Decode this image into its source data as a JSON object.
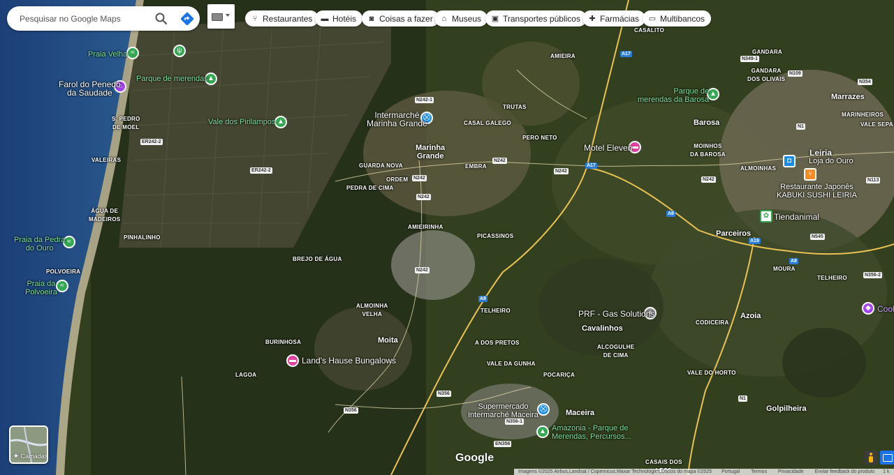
{
  "search": {
    "placeholder": "Pesquisar no Google Maps",
    "search_icon": "search-icon",
    "directions_icon": "directions-icon"
  },
  "keyboard": {
    "icon": "keyboard-icon"
  },
  "chips": [
    {
      "label": "Restaurantes",
      "icon": "fork-knife-icon"
    },
    {
      "label": "Hotéis",
      "icon": "bed-icon"
    },
    {
      "label": "Coisas a fazer",
      "icon": "camera-icon"
    },
    {
      "label": "Museus",
      "icon": "museum-icon"
    },
    {
      "label": "Transportes públicos",
      "icon": "bus-icon"
    },
    {
      "label": "Farmácias",
      "icon": "pharmacy-icon"
    },
    {
      "label": "Multibancos",
      "icon": "atm-icon"
    }
  ],
  "pois": {
    "praia_velha": "Praia Velha",
    "parque_merendas": "Parque de merendas",
    "farol": "Farol do Penedo\nda Saudade",
    "vale_pirilampos": "Vale dos Pirilampos",
    "intermarche_mg": "Intermarché\nMarinha Grande",
    "motel_eleven": "Motel Eleven",
    "parque_barosa": "Parque de\nmerendas da Barosa",
    "restaurante": "Restaurante Japonês\nKABUKI SUSHI LEIRIA",
    "loja_ouro": "Loja do Ouro",
    "tiendanimal": "Tiendanimal",
    "praia_pedra": "Praia da Pedra\ndo Ouro",
    "praia_polvoeira": "Praia da\nPolvoeira",
    "prf": "PRF - Gas Solutions",
    "lands_hause": "Land's Hause Bungalows",
    "supermercado": "Supermercado\nIntermarché Maceira",
    "amazonia": "Amazonia - Parque de\nMerendas, Percursos...",
    "cool": "Cool"
  },
  "places": {
    "marinha_grande": "Marinha\nGrande",
    "barosa": "Barosa",
    "leiria": "Leiria",
    "marrazes": "Marrazes",
    "parceiros": "Parceiros",
    "azoia": "Azoia",
    "moita": "Moita",
    "cavalinhos": "Cavalinhos",
    "maceira": "Maceira",
    "golpilheira": "Golpilheira"
  },
  "localities": {
    "amieira": "AMIEIRA",
    "casal_galego": "CASAL GALEGO",
    "trutas": "TRUTAS",
    "pero_neto": "PERO NETO",
    "guarda_nova": "GUARDA NOVA",
    "pedra_de_cima": "PEDRA DE CIMA",
    "ordem": "ORDEM",
    "embra": "EMBRA",
    "amieirinha": "AMIEIRINHA",
    "picassinos": "PICASSINOS",
    "brejo_de_agua": "BREJO DE ÁGUA",
    "almoinha_velha": "ALMOINHA\nVELHA",
    "telheiro": "TELHEIRO",
    "a_dos_pretos": "A DOS PRETOS",
    "vale_da_gunha": "VALE DA GUNHA",
    "pocarica": "POCARIÇA",
    "alcogulhe": "ALCOGULHE\nDE CIMA",
    "vale_do_horto": "VALE DO HORTO",
    "burinhosa": "BURINHOSA",
    "lagoa": "LAGOA",
    "s_pedro_moel": "S. PEDRO\nDE MOEL",
    "vaileiras": "VALEIRAS",
    "agua_de_madeiros": "ÁGUA DE\nMADEIROS",
    "pinhalinho": "PINHALINHO",
    "polvoeira": "POLVOEIRA",
    "casalito": "CASALITO",
    "gandara": "GANDARA",
    "gandara_olivais": "GANDARA\nDOS OLIVAIS",
    "marinheiros": "MARINHEIROS",
    "vale_sepa": "VALE SEPA",
    "moinhos_barosa": "MOINHOS\nDA BAROSA",
    "almoinhas": "ALMOINHAS",
    "moura": "MOURA",
    "telheiro2": "TELHEIRO",
    "codiceira": "CODICEIRA",
    "casais_dos_leos": "CASAIS DOS\nLEOS"
  },
  "roads": [
    "A17",
    "A8",
    "A19",
    "N242",
    "N242-1",
    "ER242-2",
    "N109",
    "N1",
    "N113",
    "N356",
    "N356-1",
    "EN356",
    "N349-1",
    "N354",
    "N545",
    "N356-2"
  ],
  "layers": {
    "label": "Camadas",
    "icon": "layers-icon"
  },
  "logo": "Google",
  "footer": {
    "imagery": "Imagens ©2025 Airbus,Landsat / Copernicus,Maxar Technologies,Dados do mapa ©2025",
    "country": "Portugal",
    "terms": "Termos",
    "privacy": "Privacidade",
    "feedback": "Enviar feedback do produto",
    "scale": "1 k"
  },
  "colors": {
    "accent_blue": "#1a73e8",
    "park_green": "#34a853",
    "hotel_pink": "#e040a0",
    "shop_blue": "#1a8ce8",
    "poi_purple": "#a142f4",
    "poi_orange": "#f28c28"
  }
}
